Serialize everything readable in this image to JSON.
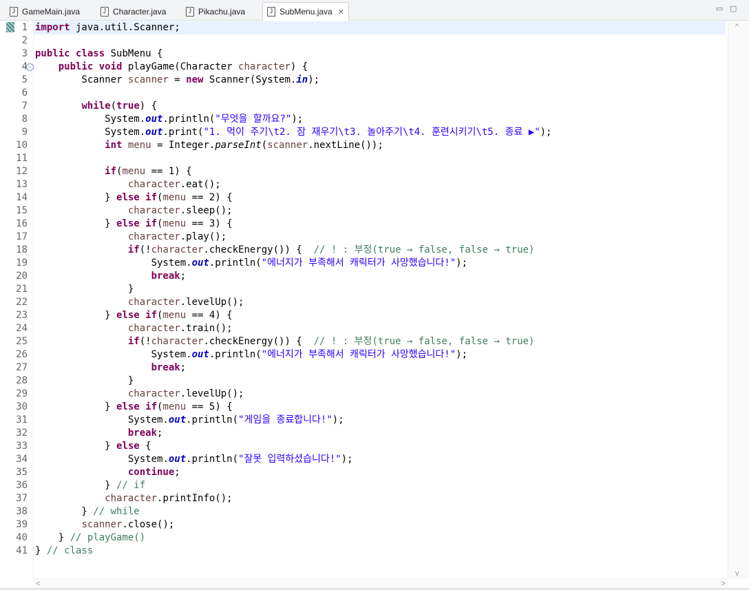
{
  "tabs": [
    {
      "label": "GameMain.java",
      "active": false
    },
    {
      "label": "Character.java",
      "active": false
    },
    {
      "label": "Pikachu.java",
      "active": false
    },
    {
      "label": "SubMenu.java",
      "active": true
    }
  ],
  "window_controls": {
    "minimize": "▭",
    "maximize": "▢"
  },
  "code_lines": [
    [
      {
        "t": "import",
        "c": "kw"
      },
      {
        "t": " java.util.Scanner;"
      }
    ],
    [],
    [
      {
        "t": "public",
        "c": "kw"
      },
      {
        "t": " "
      },
      {
        "t": "class",
        "c": "kw"
      },
      {
        "t": " SubMenu {"
      }
    ],
    [
      {
        "t": "    "
      },
      {
        "t": "public",
        "c": "kw"
      },
      {
        "t": " "
      },
      {
        "t": "void",
        "c": "kw"
      },
      {
        "t": " playGame(Character "
      },
      {
        "t": "character",
        "c": "var"
      },
      {
        "t": ") {"
      }
    ],
    [
      {
        "t": "        Scanner "
      },
      {
        "t": "scanner",
        "c": "var"
      },
      {
        "t": " = "
      },
      {
        "t": "new",
        "c": "kw"
      },
      {
        "t": " Scanner(System."
      },
      {
        "t": "in",
        "c": "fld"
      },
      {
        "t": ");"
      }
    ],
    [],
    [
      {
        "t": "        "
      },
      {
        "t": "while",
        "c": "kw"
      },
      {
        "t": "("
      },
      {
        "t": "true",
        "c": "kw"
      },
      {
        "t": ") {"
      }
    ],
    [
      {
        "t": "            System."
      },
      {
        "t": "out",
        "c": "fld"
      },
      {
        "t": ".println("
      },
      {
        "t": "\"무엇을 할까요?\"",
        "c": "str"
      },
      {
        "t": ");"
      }
    ],
    [
      {
        "t": "            System."
      },
      {
        "t": "out",
        "c": "fld"
      },
      {
        "t": ".print("
      },
      {
        "t": "\"1. 먹이 주기\\t2. 잠 재우기\\t3. 놀아주기\\t4. 훈련시키기\\t5. 종료 ▶\"",
        "c": "str"
      },
      {
        "t": ");"
      }
    ],
    [
      {
        "t": "            "
      },
      {
        "t": "int",
        "c": "kw"
      },
      {
        "t": " "
      },
      {
        "t": "menu",
        "c": "var"
      },
      {
        "t": " = Integer."
      },
      {
        "t": "parseInt",
        "c": "stat"
      },
      {
        "t": "("
      },
      {
        "t": "scanner",
        "c": "var"
      },
      {
        "t": ".nextLine());"
      }
    ],
    [],
    [
      {
        "t": "            "
      },
      {
        "t": "if",
        "c": "kw"
      },
      {
        "t": "("
      },
      {
        "t": "menu",
        "c": "var"
      },
      {
        "t": " == 1) {"
      }
    ],
    [
      {
        "t": "                "
      },
      {
        "t": "character",
        "c": "var"
      },
      {
        "t": ".eat();"
      }
    ],
    [
      {
        "t": "            } "
      },
      {
        "t": "else",
        "c": "kw"
      },
      {
        "t": " "
      },
      {
        "t": "if",
        "c": "kw"
      },
      {
        "t": "("
      },
      {
        "t": "menu",
        "c": "var"
      },
      {
        "t": " == 2) {"
      }
    ],
    [
      {
        "t": "                "
      },
      {
        "t": "character",
        "c": "var"
      },
      {
        "t": ".sleep();"
      }
    ],
    [
      {
        "t": "            } "
      },
      {
        "t": "else",
        "c": "kw"
      },
      {
        "t": " "
      },
      {
        "t": "if",
        "c": "kw"
      },
      {
        "t": "("
      },
      {
        "t": "menu",
        "c": "var"
      },
      {
        "t": " == 3) {"
      }
    ],
    [
      {
        "t": "                "
      },
      {
        "t": "character",
        "c": "var"
      },
      {
        "t": ".play();"
      }
    ],
    [
      {
        "t": "                "
      },
      {
        "t": "if",
        "c": "kw"
      },
      {
        "t": "(!"
      },
      {
        "t": "character",
        "c": "var"
      },
      {
        "t": ".checkEnergy()) {  "
      },
      {
        "t": "// ! : 부정(true → false, false → true)",
        "c": "cm"
      }
    ],
    [
      {
        "t": "                    System."
      },
      {
        "t": "out",
        "c": "fld"
      },
      {
        "t": ".println("
      },
      {
        "t": "\"에너지가 부족해서 캐릭터가 사망했습니다!\"",
        "c": "str"
      },
      {
        "t": ");"
      }
    ],
    [
      {
        "t": "                    "
      },
      {
        "t": "break",
        "c": "kw"
      },
      {
        "t": ";"
      }
    ],
    [
      {
        "t": "                }"
      }
    ],
    [
      {
        "t": "                "
      },
      {
        "t": "character",
        "c": "var"
      },
      {
        "t": ".levelUp();"
      }
    ],
    [
      {
        "t": "            } "
      },
      {
        "t": "else",
        "c": "kw"
      },
      {
        "t": " "
      },
      {
        "t": "if",
        "c": "kw"
      },
      {
        "t": "("
      },
      {
        "t": "menu",
        "c": "var"
      },
      {
        "t": " == 4) {"
      }
    ],
    [
      {
        "t": "                "
      },
      {
        "t": "character",
        "c": "var"
      },
      {
        "t": ".train();"
      }
    ],
    [
      {
        "t": "                "
      },
      {
        "t": "if",
        "c": "kw"
      },
      {
        "t": "(!"
      },
      {
        "t": "character",
        "c": "var"
      },
      {
        "t": ".checkEnergy()) {  "
      },
      {
        "t": "// ! : 부정(true → false, false → true)",
        "c": "cm"
      }
    ],
    [
      {
        "t": "                    System."
      },
      {
        "t": "out",
        "c": "fld"
      },
      {
        "t": ".println("
      },
      {
        "t": "\"에너지가 부족해서 캐릭터가 사망했습니다!\"",
        "c": "str"
      },
      {
        "t": ");"
      }
    ],
    [
      {
        "t": "                    "
      },
      {
        "t": "break",
        "c": "kw"
      },
      {
        "t": ";"
      }
    ],
    [
      {
        "t": "                }"
      }
    ],
    [
      {
        "t": "                "
      },
      {
        "t": "character",
        "c": "var"
      },
      {
        "t": ".levelUp();"
      }
    ],
    [
      {
        "t": "            } "
      },
      {
        "t": "else",
        "c": "kw"
      },
      {
        "t": " "
      },
      {
        "t": "if",
        "c": "kw"
      },
      {
        "t": "("
      },
      {
        "t": "menu",
        "c": "var"
      },
      {
        "t": " == 5) {"
      }
    ],
    [
      {
        "t": "                System."
      },
      {
        "t": "out",
        "c": "fld"
      },
      {
        "t": ".println("
      },
      {
        "t": "\"게임을 종료합니다!\"",
        "c": "str"
      },
      {
        "t": ");"
      }
    ],
    [
      {
        "t": "                "
      },
      {
        "t": "break",
        "c": "kw"
      },
      {
        "t": ";"
      }
    ],
    [
      {
        "t": "            } "
      },
      {
        "t": "else",
        "c": "kw"
      },
      {
        "t": " {"
      }
    ],
    [
      {
        "t": "                System."
      },
      {
        "t": "out",
        "c": "fld"
      },
      {
        "t": ".println("
      },
      {
        "t": "\"잘못 입력하셨습니다!\"",
        "c": "str"
      },
      {
        "t": ");"
      }
    ],
    [
      {
        "t": "                "
      },
      {
        "t": "continue",
        "c": "kw"
      },
      {
        "t": ";"
      }
    ],
    [
      {
        "t": "            } "
      },
      {
        "t": "// if",
        "c": "cm"
      }
    ],
    [
      {
        "t": "            "
      },
      {
        "t": "character",
        "c": "var"
      },
      {
        "t": ".printInfo();"
      }
    ],
    [
      {
        "t": "        } "
      },
      {
        "t": "// while",
        "c": "cm"
      }
    ],
    [
      {
        "t": "        "
      },
      {
        "t": "scanner",
        "c": "var"
      },
      {
        "t": ".close();"
      }
    ],
    [
      {
        "t": "    } "
      },
      {
        "t": "// playGame()",
        "c": "cm"
      }
    ],
    [
      {
        "t": "} "
      },
      {
        "t": "// class",
        "c": "cm"
      }
    ]
  ],
  "line_numbers": [
    "1",
    "2",
    "3",
    "4",
    "5",
    "6",
    "7",
    "8",
    "9",
    "10",
    "11",
    "12",
    "13",
    "14",
    "15",
    "16",
    "17",
    "18",
    "19",
    "20",
    "21",
    "22",
    "23",
    "24",
    "25",
    "26",
    "27",
    "28",
    "29",
    "30",
    "31",
    "32",
    "33",
    "34",
    "35",
    "36",
    "37",
    "38",
    "39",
    "40",
    "41"
  ],
  "fold_marker_line": 4,
  "current_line": 1,
  "colors": {
    "keyword": "#7f0055",
    "string": "#2a00ff",
    "comment": "#3f7f5f",
    "variable": "#6a3e3e",
    "field": "#0000c0",
    "current_line": "#e8f2fe"
  }
}
